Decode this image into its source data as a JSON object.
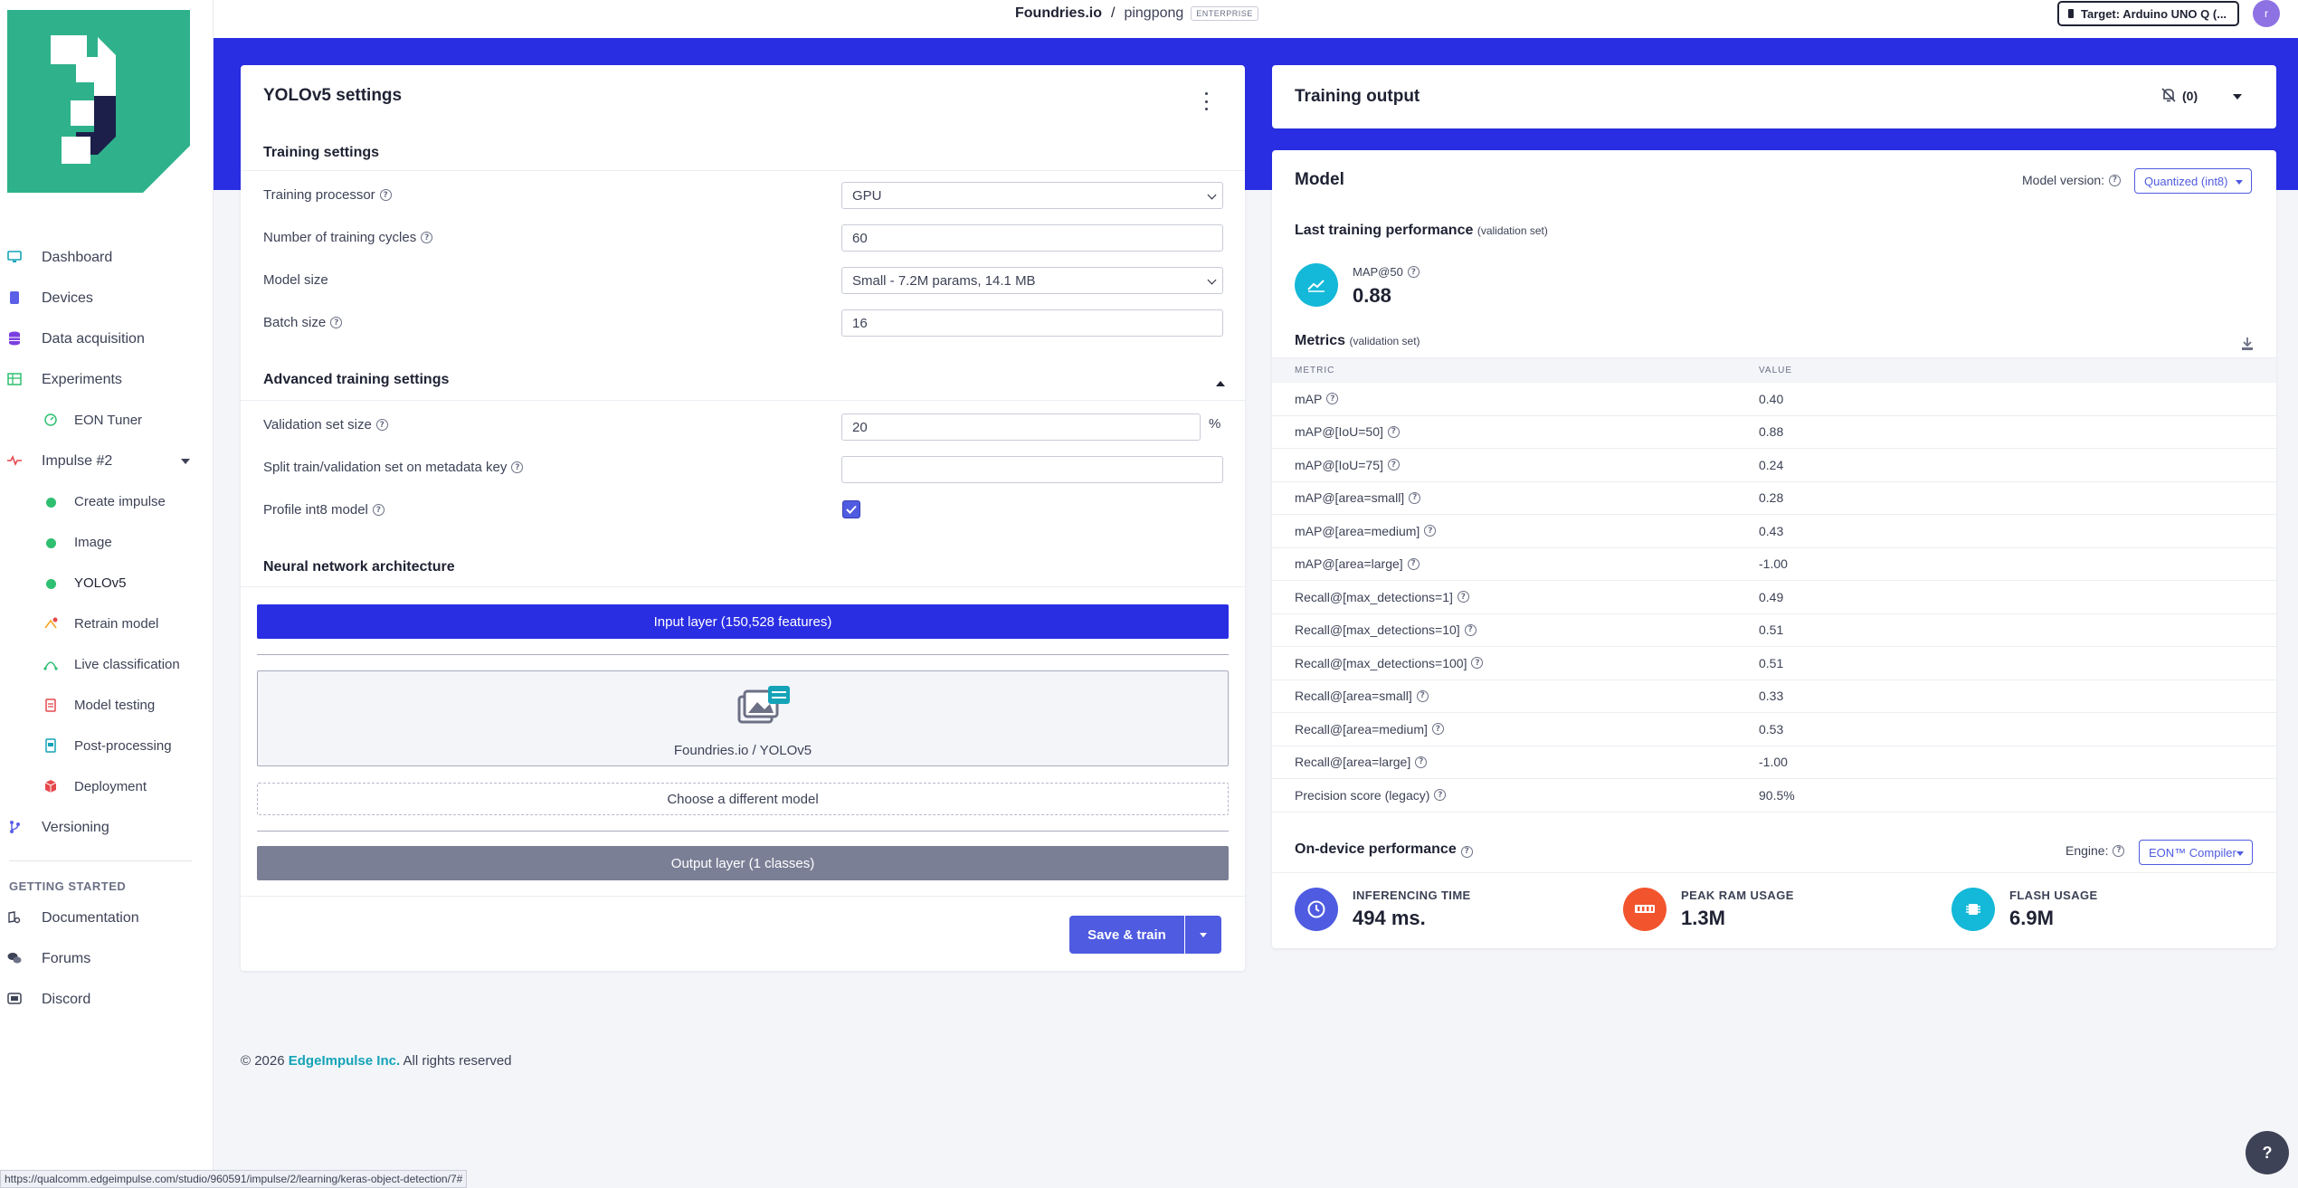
{
  "topbar": {
    "org": "Foundries.io",
    "separator": "/",
    "project": "pingpong",
    "badge": "ENTERPRISE",
    "target": "Target: Arduino UNO Q (...",
    "avatar": "r"
  },
  "sidebar": {
    "items": [
      {
        "label": "Dashboard",
        "icon": "monitor-icon"
      },
      {
        "label": "Devices",
        "icon": "device-icon"
      },
      {
        "label": "Data acquisition",
        "icon": "database-icon"
      },
      {
        "label": "Experiments",
        "icon": "table-icon"
      },
      {
        "label": "EON Tuner",
        "icon": "tuner-icon"
      },
      {
        "label": "Impulse #2",
        "icon": "pulse-icon"
      },
      {
        "label": "Create impulse",
        "icon": "status-dot"
      },
      {
        "label": "Image",
        "icon": "status-dot"
      },
      {
        "label": "YOLOv5",
        "icon": "status-dot"
      },
      {
        "label": "Retrain model",
        "icon": "retrain-icon"
      },
      {
        "label": "Live classification",
        "icon": "live-icon"
      },
      {
        "label": "Model testing",
        "icon": "testing-icon"
      },
      {
        "label": "Post-processing",
        "icon": "postprocess-icon"
      },
      {
        "label": "Deployment",
        "icon": "box-icon"
      },
      {
        "label": "Versioning",
        "icon": "branch-icon"
      }
    ],
    "getting_started_heading": "GETTING STARTED",
    "help_items": [
      {
        "label": "Documentation",
        "icon": "docs-icon"
      },
      {
        "label": "Forums",
        "icon": "forums-icon"
      },
      {
        "label": "Discord",
        "icon": "discord-icon"
      }
    ]
  },
  "settings": {
    "title": "YOLOv5 settings",
    "training_heading": "Training settings",
    "training_processor_label": "Training processor",
    "training_processor_value": "GPU",
    "cycles_label": "Number of training cycles",
    "cycles_value": "60",
    "model_size_label": "Model size",
    "model_size_value": "Small - 7.2M params, 14.1 MB",
    "batch_size_label": "Batch size",
    "batch_size_value": "16",
    "advanced_heading": "Advanced training settings",
    "validation_label": "Validation set size",
    "validation_value": "20",
    "validation_unit": "%",
    "split_label": "Split train/validation set on metadata key",
    "split_value": "",
    "profile_label": "Profile int8 model",
    "profile_checked": true,
    "nn_heading": "Neural network architecture",
    "input_layer": "Input layer (150,528 features)",
    "model_name": "Foundries.io / YOLOv5",
    "choose_model": "Choose a different model",
    "output_layer": "Output layer (1 classes)",
    "save_train": "Save & train"
  },
  "training_output": {
    "title": "Training output",
    "count": "(0)"
  },
  "model": {
    "title": "Model",
    "version_label": "Model version:",
    "version_value": "Quantized (int8)",
    "last_perf_heading": "Last training performance",
    "last_perf_note": "(validation set)",
    "map50_label": "MAP@50",
    "map50_value": "0.88",
    "metrics_heading": "Metrics",
    "metrics_note": "(validation set)",
    "col_metric": "METRIC",
    "col_value": "VALUE",
    "metrics": [
      {
        "name": "mAP",
        "value": "0.40"
      },
      {
        "name": "mAP@[IoU=50]",
        "value": "0.88"
      },
      {
        "name": "mAP@[IoU=75]",
        "value": "0.24"
      },
      {
        "name": "mAP@[area=small]",
        "value": "0.28"
      },
      {
        "name": "mAP@[area=medium]",
        "value": "0.43"
      },
      {
        "name": "mAP@[area=large]",
        "value": "-1.00"
      },
      {
        "name": "Recall@[max_detections=1]",
        "value": "0.49"
      },
      {
        "name": "Recall@[max_detections=10]",
        "value": "0.51"
      },
      {
        "name": "Recall@[max_detections=100]",
        "value": "0.51"
      },
      {
        "name": "Recall@[area=small]",
        "value": "0.33"
      },
      {
        "name": "Recall@[area=medium]",
        "value": "0.53"
      },
      {
        "name": "Recall@[area=large]",
        "value": "-1.00"
      },
      {
        "name": "Precision score (legacy)",
        "value": "90.5%"
      }
    ],
    "on_device_heading": "On-device performance",
    "engine_label": "Engine:",
    "engine_value": "EON™ Compiler",
    "inferencing_label": "INFERENCING TIME",
    "inferencing_value": "494 ms.",
    "ram_label": "PEAK RAM USAGE",
    "ram_value": "1.3M",
    "flash_label": "FLASH USAGE",
    "flash_value": "6.9M"
  },
  "footer": {
    "year": "© 2026",
    "brand": "EdgeImpulse Inc.",
    "rights": "All rights reserved"
  },
  "statusbar": {
    "url": "https://qualcomm.edgeimpulse.com/studio/960591/impulse/2/learning/keras-object-detection/7#"
  },
  "colors": {
    "accent": "#2a2ee3",
    "button": "#4f5be0",
    "brand_teal": "#2fb28b",
    "status_green": "#2fbf71"
  }
}
